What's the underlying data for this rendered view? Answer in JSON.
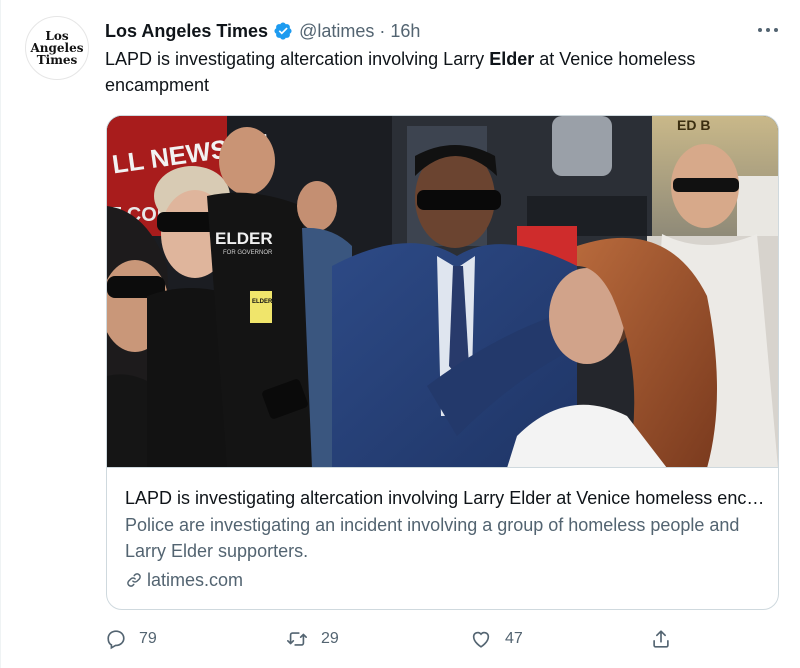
{
  "tweet": {
    "avatar_text": [
      "Los",
      "Angeles",
      "Times"
    ],
    "author_name": "Los Angeles Times",
    "handle": "@latimes",
    "separator": "·",
    "time": "16h",
    "more": "•••",
    "text_before": "LAPD is investigating altercation involving Larry ",
    "text_bold": "Elder",
    "text_after": " at Venice homeless encampment"
  },
  "card": {
    "image_texts": {
      "banner": "LL NEWSOM",
      "banner2": "T COM",
      "shirt": "ELDER",
      "shirt_sub": "FOR GOVERNOR",
      "badge": "ELDER",
      "sign": "ED B"
    },
    "title": "LAPD is investigating altercation involving Larry Elder at Venice homeless encampment",
    "description": "Police are investigating an incident involving a group of homeless people and Larry Elder supporters.",
    "domain": "latimes.com"
  },
  "actions": {
    "reply_count": "79",
    "retweet_count": "29",
    "like_count": "47"
  },
  "colors": {
    "verified": "#1d9bf0",
    "secondary_text": "#536471",
    "border": "#cfd9de"
  }
}
